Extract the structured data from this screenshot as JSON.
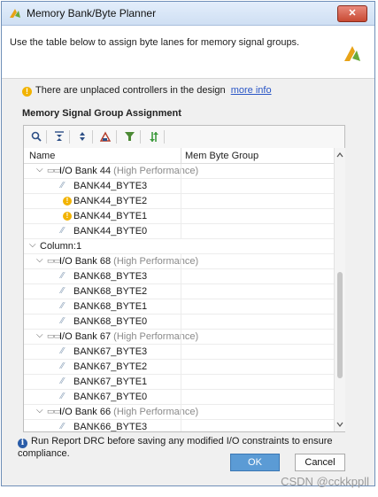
{
  "window": {
    "title": "Memory Bank/Byte Planner",
    "close_label": "✕"
  },
  "header": {
    "description": "Use the table below to assign byte lanes for memory signal groups."
  },
  "warning": {
    "text": "There are unplaced controllers in the design",
    "link": "more info"
  },
  "section": {
    "title": "Memory Signal Group Assignment"
  },
  "toolbar": {
    "icons": [
      "search-icon",
      "collapse-all-icon",
      "expand-all-icon",
      "auto-assign-icon",
      "filter-icon",
      "sort-icon"
    ]
  },
  "table": {
    "columns": [
      "Name",
      "Mem Byte Group"
    ],
    "rows": [
      {
        "type": "bank",
        "name": "I/O Bank 44",
        "suffix": "(High Performance)"
      },
      {
        "type": "byte",
        "name": "BANK44_BYTE3",
        "icon": "byte-lane-icon",
        "dropdown": true
      },
      {
        "type": "byte",
        "name": "BANK44_BYTE2",
        "icon": "warning-icon",
        "dropdown": false
      },
      {
        "type": "byte",
        "name": "BANK44_BYTE1",
        "icon": "warning-icon",
        "dropdown": false
      },
      {
        "type": "byte",
        "name": "BANK44_BYTE0",
        "icon": "byte-lane-icon",
        "dropdown": true
      },
      {
        "type": "column",
        "name": "Column:1"
      },
      {
        "type": "bank",
        "name": "I/O Bank 68",
        "suffix": "(High Performance)"
      },
      {
        "type": "byte",
        "name": "BANK68_BYTE3",
        "icon": "byte-lane-icon",
        "dropdown": true
      },
      {
        "type": "byte",
        "name": "BANK68_BYTE2",
        "icon": "byte-lane-icon",
        "dropdown": true
      },
      {
        "type": "byte",
        "name": "BANK68_BYTE1",
        "icon": "byte-lane-icon",
        "dropdown": true
      },
      {
        "type": "byte",
        "name": "BANK68_BYTE0",
        "icon": "byte-lane-icon",
        "dropdown": true
      },
      {
        "type": "bank",
        "name": "I/O Bank 67",
        "suffix": "(High Performance)"
      },
      {
        "type": "byte",
        "name": "BANK67_BYTE3",
        "icon": "byte-lane-icon",
        "dropdown": true
      },
      {
        "type": "byte",
        "name": "BANK67_BYTE2",
        "icon": "byte-lane-icon",
        "dropdown": true
      },
      {
        "type": "byte",
        "name": "BANK67_BYTE1",
        "icon": "byte-lane-icon",
        "dropdown": true
      },
      {
        "type": "byte",
        "name": "BANK67_BYTE0",
        "icon": "byte-lane-icon",
        "dropdown": true
      },
      {
        "type": "bank",
        "name": "I/O Bank 66",
        "suffix": "(High Performance)"
      },
      {
        "type": "byte",
        "name": "BANK66_BYTE3",
        "icon": "byte-lane-icon",
        "dropdown": true
      }
    ]
  },
  "info": {
    "text": "Run Report DRC before saving any modified I/O constraints to ensure compliance."
  },
  "buttons": {
    "ok": "OK",
    "cancel": "Cancel"
  },
  "watermark": "CSDN @cckkppll",
  "colors": {
    "ok_button": "#5b9bd5",
    "warning": "#f2b300",
    "link": "#2a56c6",
    "info": "#2a5ca8"
  }
}
